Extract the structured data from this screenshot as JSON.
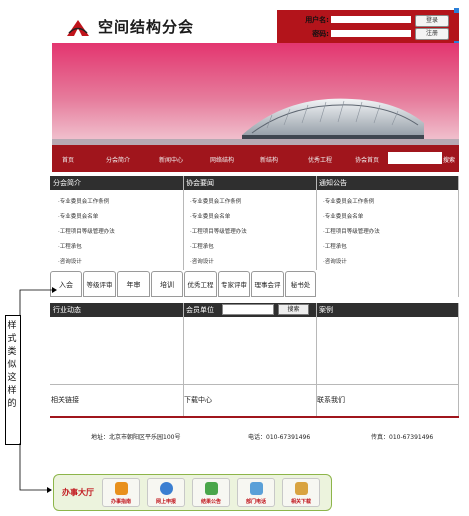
{
  "header": {
    "title": "空间结构分会",
    "username_label": "用户名:",
    "password_label": "密码:",
    "login_button": "登录",
    "register_button": "注册"
  },
  "nav": {
    "items": [
      "首页",
      "分会简介",
      "新闻中心",
      "网络结构",
      "新结构",
      "优秀工程",
      "协会首页"
    ],
    "search_button": "搜索"
  },
  "sections": {
    "intro": {
      "title": "分会简介",
      "items": [
        "·专业委员会工作条例",
        "·专业委员会名单",
        "·工程项目等级管理办法",
        "·工程承包",
        "·咨询设计"
      ]
    },
    "news": {
      "title": "协会要闻",
      "items": [
        "·专业委员会工作条例",
        "·专业委员会名单",
        "·工程项目等级管理办法",
        "·工程承包",
        "·咨询设计"
      ]
    },
    "notice": {
      "title": "通知公告",
      "items": [
        "·专业委员会工作条例",
        "·专业委员会名单",
        "·工程项目等级管理办法",
        "·工程承包",
        "·咨询设计"
      ]
    }
  },
  "tabs_left": [
    "入会",
    "等级评审",
    "年审",
    "培训"
  ],
  "tabs_right": [
    "优秀工程",
    "专家评审",
    "理事会评审",
    "秘书处"
  ],
  "middle": {
    "industry_title": "行业动态",
    "member_title": "会员单位",
    "member_search_button": "搜索",
    "cases_title": "案例"
  },
  "links": {
    "related": "相关链接",
    "download": "下载中心",
    "contact": "联系我们"
  },
  "footer": {
    "address": "地址：北京市朝阳区平乐园100号",
    "phone": "电话：010-67391496",
    "fax": "传真：010-67391496"
  },
  "annotation": {
    "text": "样式类似这样的"
  },
  "service_bar": {
    "title": "办事大厅",
    "buttons": [
      {
        "label": "办事指南",
        "icon": "guide-icon"
      },
      {
        "label": "网上申报",
        "icon": "online-apply-icon"
      },
      {
        "label": "结果公告",
        "icon": "results-icon"
      },
      {
        "label": "部门电话",
        "icon": "phone-icon"
      },
      {
        "label": "相关下载",
        "icon": "download-icon"
      }
    ]
  },
  "colors": {
    "brand_red": "#a0151c",
    "login_red": "#b3141b",
    "section_header": "#2f2f2f",
    "banner_sky": "#d84a7e",
    "service_green": "#8db54a"
  }
}
